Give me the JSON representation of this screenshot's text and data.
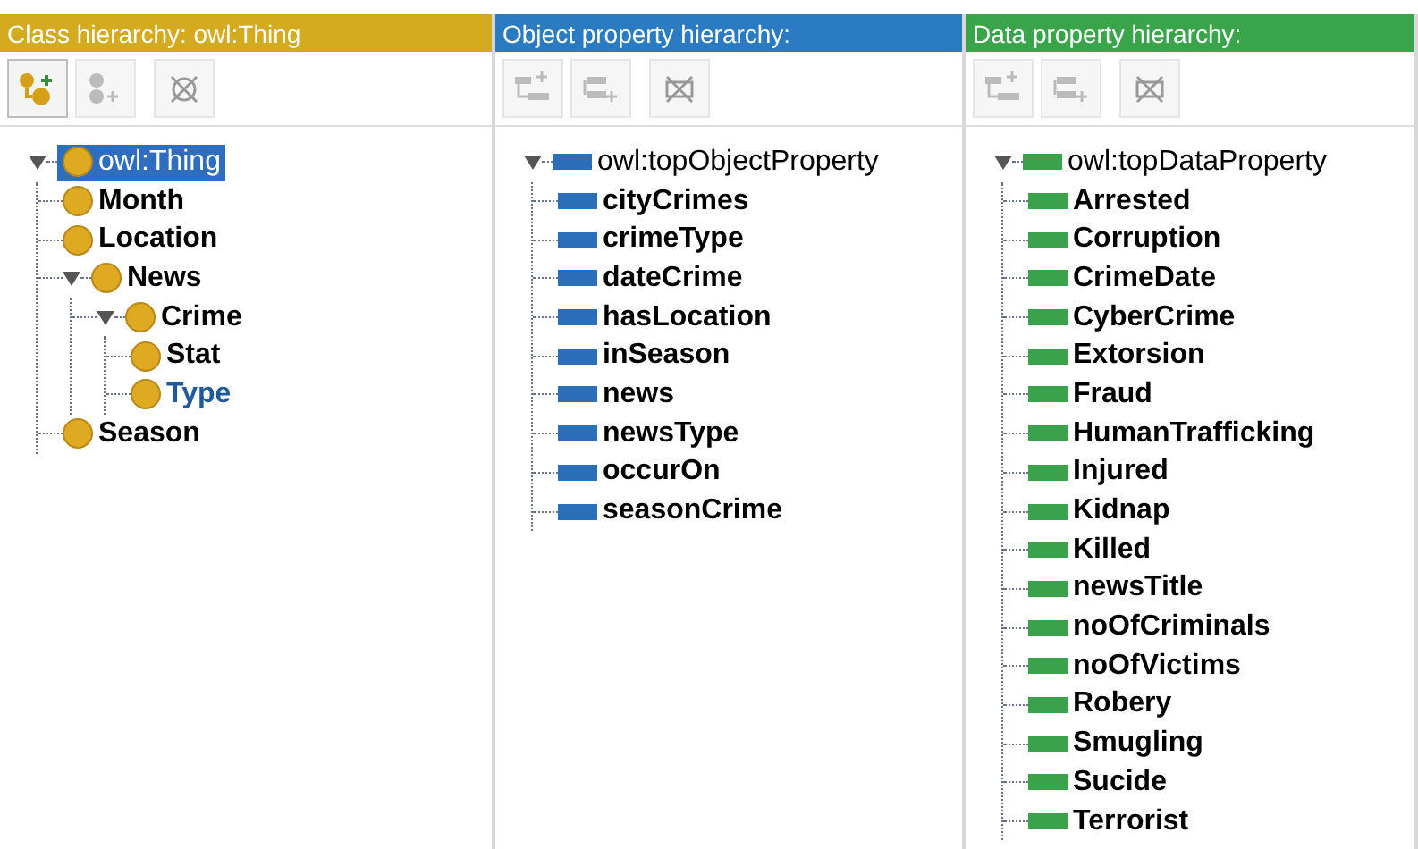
{
  "panels": [
    {
      "kind": "class",
      "title": "Class hierarchy: owl:Thing",
      "color": "#d4aa1e",
      "toolbar": [
        {
          "kind": "add_child",
          "disabled": false
        },
        {
          "kind": "add_sibling",
          "disabled": true
        },
        {
          "kind": "delete",
          "disabled": true
        }
      ],
      "tree": [
        {
          "label": "owl:Thing",
          "selected": true,
          "highlighted": false,
          "expanded": true,
          "children": [
            {
              "label": "Month",
              "selected": false,
              "highlighted": false
            },
            {
              "label": "Location",
              "selected": false,
              "highlighted": false
            },
            {
              "label": "News",
              "selected": false,
              "highlighted": false,
              "expanded": true,
              "children": [
                {
                  "label": "Crime",
                  "selected": false,
                  "highlighted": false,
                  "expanded": true,
                  "children": [
                    {
                      "label": "Stat",
                      "selected": false,
                      "highlighted": false
                    },
                    {
                      "label": "Type",
                      "selected": false,
                      "highlighted": true
                    }
                  ]
                }
              ]
            },
            {
              "label": "Season",
              "selected": false,
              "highlighted": false
            }
          ]
        }
      ]
    },
    {
      "kind": "object",
      "title": "Object property hierarchy:",
      "color": "#2a7bc2",
      "toolbar": [
        {
          "kind": "add_child",
          "disabled": true
        },
        {
          "kind": "add_sibling",
          "disabled": true
        },
        {
          "kind": "delete",
          "disabled": true
        }
      ],
      "tree": [
        {
          "label": "owl:topObjectProperty",
          "selected": false,
          "highlighted": false,
          "expanded": true,
          "children": [
            {
              "label": "cityCrimes",
              "selected": false,
              "highlighted": false
            },
            {
              "label": "crimeType",
              "selected": false,
              "highlighted": false
            },
            {
              "label": "dateCrime",
              "selected": false,
              "highlighted": false
            },
            {
              "label": "hasLocation",
              "selected": false,
              "highlighted": false
            },
            {
              "label": "inSeason",
              "selected": false,
              "highlighted": false
            },
            {
              "label": "news",
              "selected": false,
              "highlighted": false
            },
            {
              "label": "newsType",
              "selected": false,
              "highlighted": false
            },
            {
              "label": "occurOn",
              "selected": false,
              "highlighted": false
            },
            {
              "label": "seasonCrime",
              "selected": false,
              "highlighted": false
            }
          ]
        }
      ]
    },
    {
      "kind": "data",
      "title": "Data property hierarchy:",
      "color": "#3aa44b",
      "toolbar": [
        {
          "kind": "add_child",
          "disabled": true
        },
        {
          "kind": "add_sibling",
          "disabled": true
        },
        {
          "kind": "delete",
          "disabled": true
        }
      ],
      "tree": [
        {
          "label": "owl:topDataProperty",
          "selected": false,
          "highlighted": false,
          "expanded": true,
          "children": [
            {
              "label": "Arrested",
              "selected": false,
              "highlighted": false
            },
            {
              "label": "Corruption",
              "selected": false,
              "highlighted": false
            },
            {
              "label": "CrimeDate",
              "selected": false,
              "highlighted": false
            },
            {
              "label": "CyberCrime",
              "selected": false,
              "highlighted": false
            },
            {
              "label": "Extorsion",
              "selected": false,
              "highlighted": false
            },
            {
              "label": "Fraud",
              "selected": false,
              "highlighted": false
            },
            {
              "label": "HumanTrafficking",
              "selected": false,
              "highlighted": false
            },
            {
              "label": "Injured",
              "selected": false,
              "highlighted": false
            },
            {
              "label": "Kidnap",
              "selected": false,
              "highlighted": false
            },
            {
              "label": "Killed",
              "selected": false,
              "highlighted": false
            },
            {
              "label": "newsTitle",
              "selected": false,
              "highlighted": false
            },
            {
              "label": "noOfCriminals",
              "selected": false,
              "highlighted": false
            },
            {
              "label": "noOfVictims",
              "selected": false,
              "highlighted": false
            },
            {
              "label": "Robery",
              "selected": false,
              "highlighted": false
            },
            {
              "label": "Smugling",
              "selected": false,
              "highlighted": false
            },
            {
              "label": "Sucide",
              "selected": false,
              "highlighted": false
            },
            {
              "label": "Terrorist",
              "selected": false,
              "highlighted": false
            }
          ]
        }
      ]
    }
  ]
}
